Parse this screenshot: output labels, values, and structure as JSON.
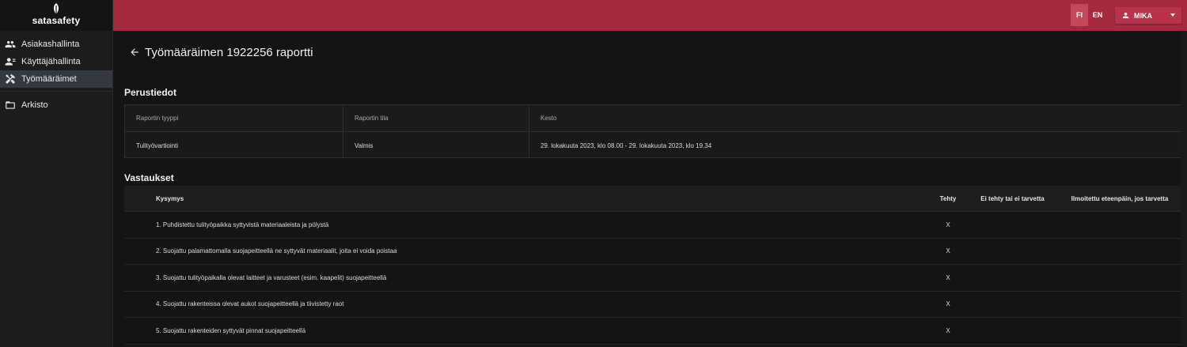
{
  "brand": {
    "name": "satasafety"
  },
  "sidebar": {
    "items": [
      {
        "label": "Asiakashallinta",
        "icon": "customers-icon"
      },
      {
        "label": "Käyttäjähallinta",
        "icon": "user-manage-icon"
      },
      {
        "label": "Työmääräimet",
        "icon": "tools-icon",
        "active": true
      },
      {
        "label": "Arkisto",
        "icon": "folder-open-icon"
      }
    ]
  },
  "topbar": {
    "lang_fi": "FI",
    "lang_en": "EN",
    "user_name": "MIKA",
    "accent_color": "#a52a40"
  },
  "page": {
    "title": "Työmääräimen 1922256 raportti"
  },
  "basic_info": {
    "section_title": "Perustiedot",
    "headers": [
      "Raportin tyyppi",
      "Raportin tila",
      "Kesto"
    ],
    "values": [
      "Tulityövartiointi",
      "Valmis",
      "29. lokakuuta 2023, klo 08.00 - 29. lokakuuta 2023, klo 19.34"
    ]
  },
  "answers": {
    "section_title": "Vastaukset",
    "headers": {
      "question": "Kysymys",
      "done": "Tehty",
      "not_done": "Ei tehty tai ei tarvetta",
      "reported": "Ilmoitettu eteenpäin, jos tarvetta"
    },
    "rows": [
      {
        "question": "1. Puhdistettu tulityöpaikka syttyvistä materiaaleista ja pölystä",
        "done": "X",
        "not_done": "",
        "reported": ""
      },
      {
        "question": "2. Suojattu palamattomalla suojapeitteellä ne syttyvät materiaalit, joita ei voida poistaa",
        "done": "X",
        "not_done": "",
        "reported": ""
      },
      {
        "question": "3. Suojattu tulityöpaikalla olevat laitteet ja varusteet (esim. kaapelit) suojapeitteellä",
        "done": "X",
        "not_done": "",
        "reported": ""
      },
      {
        "question": "4. Suojattu rakenteissa olevat aukot suojapeitteellä ja tiivistetty raot",
        "done": "X",
        "not_done": "",
        "reported": ""
      },
      {
        "question": "5. Suojattu rakenteiden syttyvät pinnat suojapeitteellä",
        "done": "X",
        "not_done": "",
        "reported": ""
      }
    ]
  }
}
